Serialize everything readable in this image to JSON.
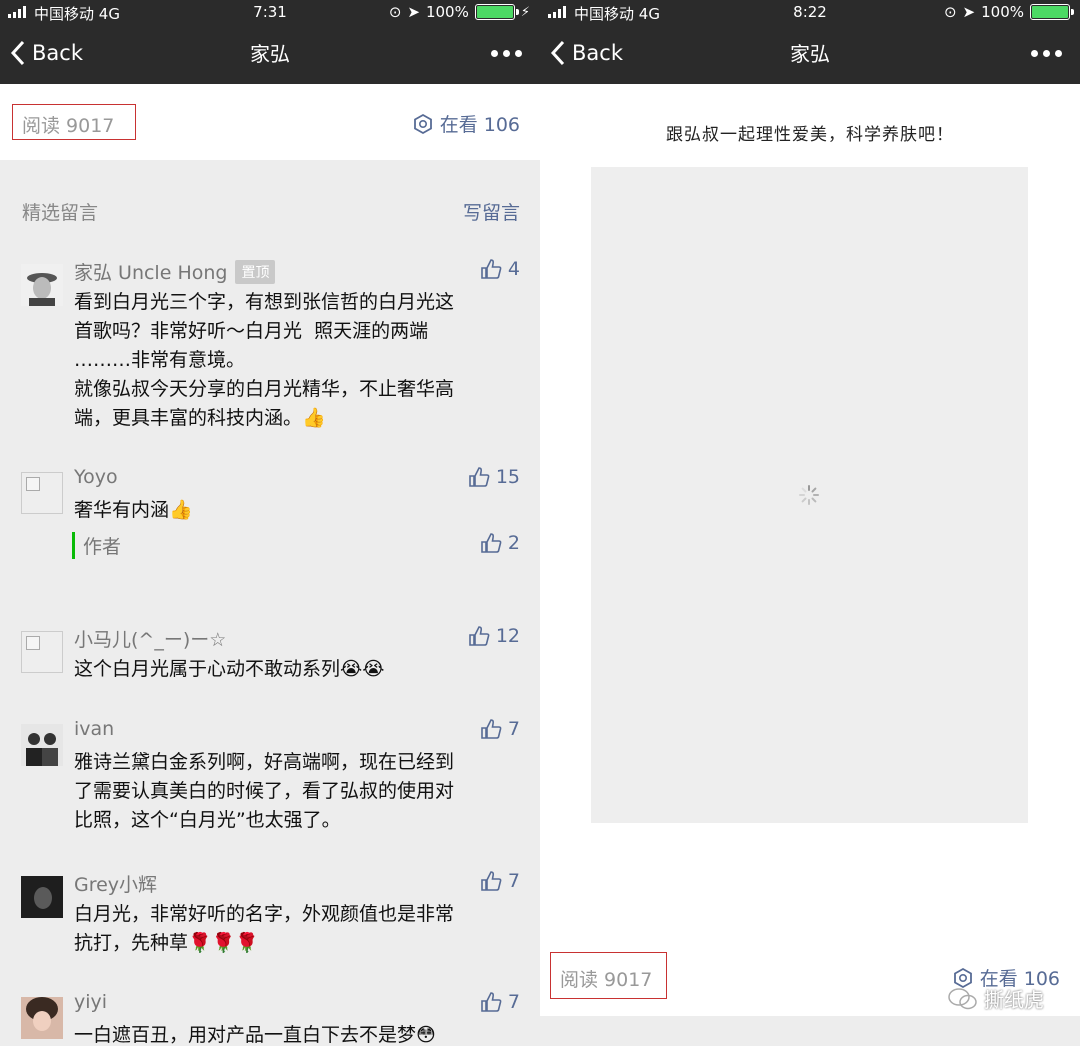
{
  "left": {
    "status": {
      "carrier": "中国移动",
      "network": "4G",
      "time": "7:31",
      "battery": "100%"
    },
    "nav": {
      "back": "Back",
      "title": "家弘"
    },
    "reads": "阅读 9017",
    "watching": "在看 106",
    "section_title": "精选留言",
    "write_comment": "写留言",
    "comments": [
      {
        "name": "家弘 Uncle Hong",
        "badge": "置顶",
        "likes": "4",
        "text": "看到白月光三个字，有想到张信哲的白月光这\n首歌吗？非常好听～白月光  照天涯的两端\n………非常有意境。\n就像弘叔今天分享的白月光精华，不止奢华高\n端，更具丰富的科技内涵。👍"
      },
      {
        "name": "Yoyo",
        "likes": "15",
        "text": "奢华有内涵👍",
        "reply_label": "作者",
        "reply_likes": "2"
      },
      {
        "name": "小马儿(^_ー)ー☆",
        "likes": "12",
        "text": "这个白月光属于心动不敢动系列😭😭"
      },
      {
        "name": "ivan",
        "likes": "7",
        "text": "雅诗兰黛白金系列啊，好高端啊，现在已经到\n了需要认真美白的时候了，看了弘叔的使用对\n比照，这个“白月光”也太强了。"
      },
      {
        "name": "Grey小辉",
        "likes": "7",
        "text": "白月光，非常好听的名字，外观颜值也是非常\n抗打，先种草🌹🌹🌹"
      },
      {
        "name": "yiyi",
        "likes": "7",
        "text": "一白遮百丑，用对产品一直白下去不是梦😳"
      }
    ]
  },
  "right": {
    "status": {
      "carrier": "中国移动",
      "network": "4G",
      "time": "8:22",
      "battery": "100%"
    },
    "nav": {
      "back": "Back",
      "title": "家弘"
    },
    "slogan": "跟弘叔一起理性爱美，科学养肤吧！",
    "reads": "阅读 9017",
    "watching": "在看 106",
    "watermark": "撕纸虎"
  }
}
